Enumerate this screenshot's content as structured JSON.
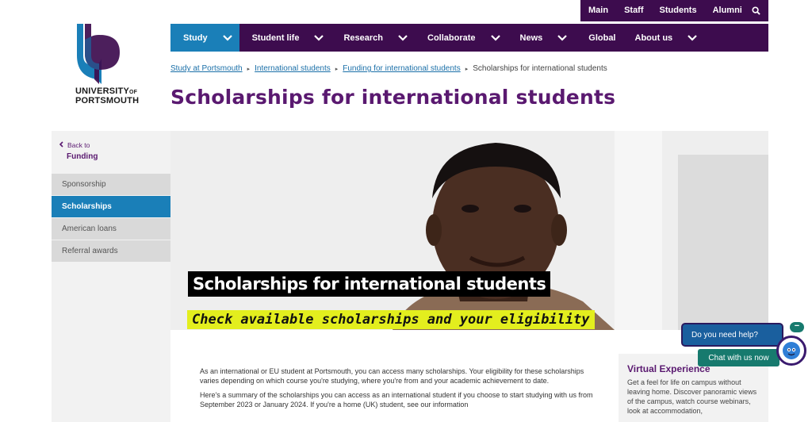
{
  "utility_nav": {
    "items": [
      "Main",
      "Staff",
      "Students",
      "Alumni"
    ],
    "search_icon": "search-icon"
  },
  "logo": {
    "line1": "UNIVERSITY",
    "of": "OF",
    "line2": "PORTSMOUTH",
    "colors": {
      "blue": "#1a7fb8",
      "purple": "#3d0c4e"
    }
  },
  "main_nav": {
    "items": [
      {
        "label": "Study",
        "has_dropdown": true,
        "active": true
      },
      {
        "label": "Student life",
        "has_dropdown": true
      },
      {
        "label": "Research",
        "has_dropdown": true
      },
      {
        "label": "Collaborate",
        "has_dropdown": true
      },
      {
        "label": "News",
        "has_dropdown": true
      },
      {
        "label": "Global",
        "has_dropdown": false
      },
      {
        "label": "About us",
        "has_dropdown": true
      }
    ]
  },
  "breadcrumb": {
    "links": [
      "Study at Portsmouth",
      "International students",
      "Funding for international students"
    ],
    "current": "Scholarships for international students"
  },
  "page_title": "Scholarships for international students",
  "sidebar": {
    "back_label": "Back to",
    "back_title": "Funding",
    "items": [
      {
        "label": "Sponsorship"
      },
      {
        "label": "Scholarships",
        "active": true
      },
      {
        "label": "American loans"
      },
      {
        "label": "Referral awards"
      }
    ]
  },
  "hero": {
    "heading": "Scholarships for international students",
    "subheading": "Check available scholarships and your eligibility"
  },
  "intro": {
    "p1": "As an international or EU student at Portsmouth, you can access many scholarships. Your eligibility for these scholarships varies depending on which course you're studying, where you're from and your academic achievement to date.",
    "p2": "Here's a summary of the scholarships you can access as an international student if you choose to start studying with us from September 2023 or January 2024. If you're a home (UK) student, see our information"
  },
  "side_panel": {
    "title": "Virtual Experience",
    "text": "Get a feel for life on campus without leaving home. Discover panoramic views of the campus, watch course webinars, look at accommodation,"
  },
  "chat": {
    "help_label": "Do you need help?",
    "minimize_label": "−",
    "chat_label": "Chat with us now"
  },
  "colors": {
    "brand_purple": "#3d0c4e",
    "title_purple": "#5a1970",
    "brand_blue": "#1a7fb8",
    "highlight_yellow": "#e3ee1e",
    "chat_teal": "#177a6e"
  }
}
